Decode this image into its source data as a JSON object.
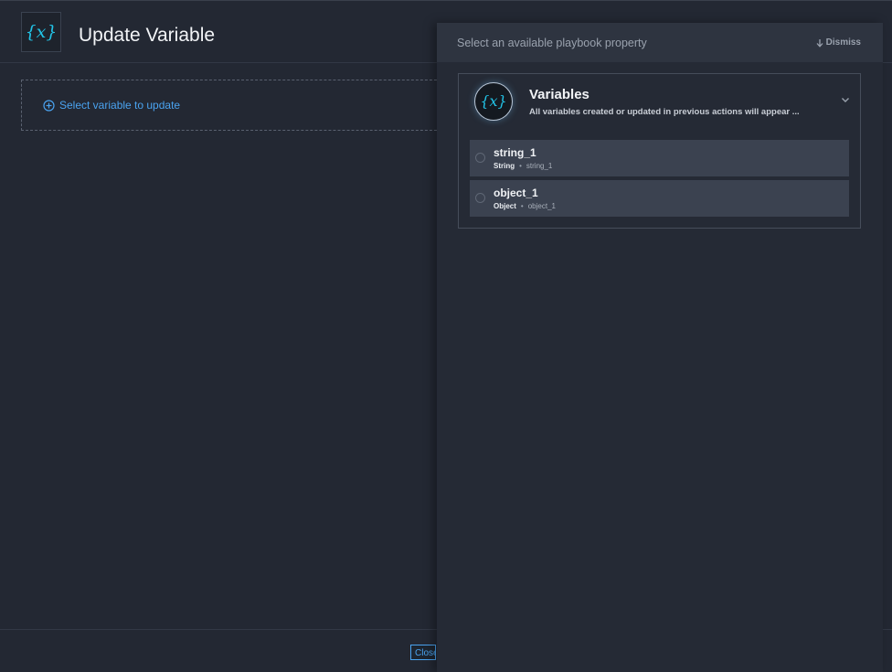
{
  "header": {
    "title": "Update Variable",
    "icon": "variable-icon"
  },
  "main": {
    "select_label": "Select variable to update"
  },
  "footer": {
    "close_label": "Close"
  },
  "panel": {
    "title": "Select an available playbook property",
    "dismiss_label": "Dismiss",
    "variables": {
      "title": "Variables",
      "subtitle": "All variables created or updated in previous actions will appear ...",
      "items": [
        {
          "name": "string_1",
          "type": "String",
          "key": "string_1"
        },
        {
          "name": "object_1",
          "type": "Object",
          "key": "object_1"
        }
      ]
    }
  },
  "colors": {
    "accent": "#4aa3f0",
    "icon_cyan": "#22c3e6",
    "background": "#232833"
  }
}
